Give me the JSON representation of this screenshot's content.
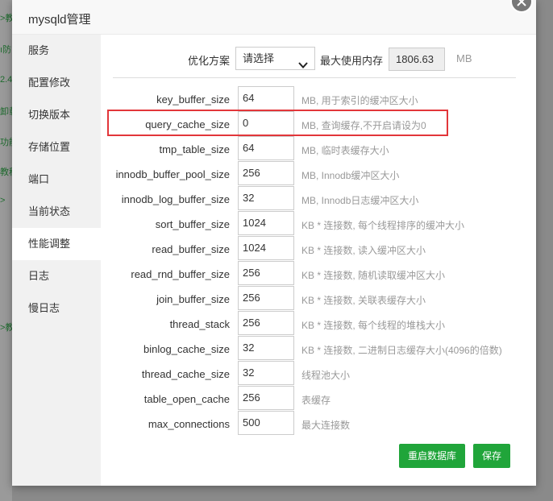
{
  "window": {
    "title": "mysqld管理"
  },
  "background_fragments": [
    "ı防",
    "2.4",
    "卸载",
    "功能",
    "教程",
    ">",
    ">教"
  ],
  "sidebar": {
    "items": [
      {
        "label": "服务"
      },
      {
        "label": "配置修改"
      },
      {
        "label": "切换版本"
      },
      {
        "label": "存储位置"
      },
      {
        "label": "端口"
      },
      {
        "label": "当前状态"
      },
      {
        "label": "性能调整",
        "active": true
      },
      {
        "label": "日志"
      },
      {
        "label": "慢日志"
      }
    ]
  },
  "optimize": {
    "scheme_label": "优化方案",
    "scheme_value": "请选择",
    "max_mem_label": "最大使用内存",
    "max_mem_value": "1806.63",
    "max_mem_unit": "MB"
  },
  "params": [
    {
      "name": "key_buffer_size",
      "value": "64",
      "desc": "MB, 用于索引的缓冲区大小"
    },
    {
      "name": "query_cache_size",
      "value": "0",
      "desc": "MB, 查询缓存,不开启请设为0"
    },
    {
      "name": "tmp_table_size",
      "value": "64",
      "desc": "MB, 临时表缓存大小"
    },
    {
      "name": "innodb_buffer_pool_size",
      "value": "256",
      "desc": "MB, Innodb缓冲区大小"
    },
    {
      "name": "innodb_log_buffer_size",
      "value": "32",
      "desc": "MB, Innodb日志缓冲区大小"
    },
    {
      "name": "sort_buffer_size",
      "value": "1024",
      "desc": "KB * 连接数, 每个线程排序的缓冲大小"
    },
    {
      "name": "read_buffer_size",
      "value": "1024",
      "desc": "KB * 连接数, 读入缓冲区大小"
    },
    {
      "name": "read_rnd_buffer_size",
      "value": "256",
      "desc": "KB * 连接数, 随机读取缓冲区大小"
    },
    {
      "name": "join_buffer_size",
      "value": "256",
      "desc": "KB * 连接数, 关联表缓存大小"
    },
    {
      "name": "thread_stack",
      "value": "256",
      "desc": "KB * 连接数, 每个线程的堆栈大小"
    },
    {
      "name": "binlog_cache_size",
      "value": "32",
      "desc": "KB * 连接数, 二进制日志缓存大小(4096的倍数)"
    },
    {
      "name": "thread_cache_size",
      "value": "32",
      "desc": "线程池大小"
    },
    {
      "name": "table_open_cache",
      "value": "256",
      "desc": "表缓存"
    },
    {
      "name": "max_connections",
      "value": "500",
      "desc": "最大连接数"
    }
  ],
  "buttons": {
    "restart": "重启数据库",
    "save": "保存"
  },
  "colors": {
    "accent": "#20a53a",
    "highlight": "#e2363a",
    "sidebar_bg": "#f1f1f1"
  }
}
